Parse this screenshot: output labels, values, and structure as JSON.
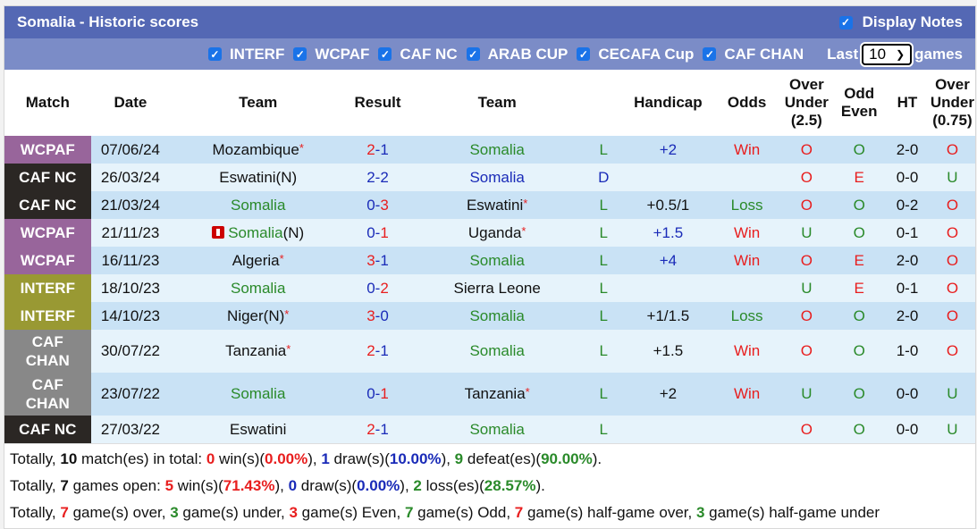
{
  "header": {
    "title": "Somalia - Historic scores",
    "display_notes_label": "Display Notes",
    "display_notes_checked": true
  },
  "filters": {
    "items": [
      {
        "label": "INTERF",
        "checked": true
      },
      {
        "label": "WCPAF",
        "checked": true
      },
      {
        "label": "CAF NC",
        "checked": true
      },
      {
        "label": "ARAB CUP",
        "checked": true
      },
      {
        "label": "CECAFA Cup",
        "checked": true
      },
      {
        "label": "CAF CHAN",
        "checked": true
      }
    ],
    "last_label": "Last",
    "games_label": "games",
    "last_value": "10",
    "checkmark": "✓",
    "chevron": "⌄"
  },
  "colors": {
    "WCPAF": "#98659b",
    "CAF NC": "#2b2724",
    "INTERF": "#999933",
    "CAF CHAN": "#888888"
  },
  "table": {
    "headers": {
      "match": "Match",
      "date": "Date",
      "team1": "Team",
      "result": "Result",
      "team2": "Team",
      "hl": "",
      "handicap": "Handicap",
      "odds": "Odds",
      "ou25_1": "Over",
      "ou25_2": "Under",
      "ou25_3": "(2.5)",
      "oe_1": "Odd",
      "oe_2": "Even",
      "ht": "HT",
      "ou075_1": "Over",
      "ou075_2": "Under",
      "ou075_3": "(0.75)"
    },
    "rows": [
      {
        "match": "WCPAF",
        "date": "07/06/24",
        "team1": "Mozambique",
        "team1_star": "*",
        "team1_flag": false,
        "team1_color": "black",
        "score1": "2",
        "score2": "1",
        "team2": "Somalia",
        "team2_star": "",
        "team2_color": "green",
        "wdl": "L",
        "handicap": "+2",
        "hcolor": "blue",
        "odds": "Win",
        "ou": "O",
        "oe": "O",
        "ht": "2-0",
        "ou2": "O"
      },
      {
        "match": "CAF NC",
        "date": "26/03/24",
        "team1": "Eswatini(N)",
        "team1_star": "",
        "team1_flag": false,
        "team1_color": "black",
        "score1": "2",
        "score2": "2",
        "team2": "Somalia",
        "team2_star": "",
        "team2_color": "blue",
        "wdl": "D",
        "handicap": "",
        "hcolor": "black",
        "odds": "",
        "ou": "O",
        "oe": "E",
        "ht": "0-0",
        "ou2": "U"
      },
      {
        "match": "CAF NC",
        "date": "21/03/24",
        "team1": "Somalia",
        "team1_star": "",
        "team1_flag": false,
        "team1_color": "green",
        "score1": "0",
        "score2": "3",
        "team2": "Eswatini",
        "team2_star": "*",
        "team2_color": "black",
        "wdl": "L",
        "handicap": "+0.5/1",
        "hcolor": "black",
        "odds": "Loss",
        "ou": "O",
        "oe": "O",
        "ht": "0-2",
        "ou2": "O"
      },
      {
        "match": "WCPAF",
        "date": "21/11/23",
        "team1": "Somalia",
        "team1_suffix": "(N)",
        "team1_star": "",
        "team1_flag": true,
        "team1_color": "green",
        "score1": "0",
        "score2": "1",
        "team2": "Uganda",
        "team2_star": "*",
        "team2_color": "black",
        "wdl": "L",
        "handicap": "+1.5",
        "hcolor": "blue",
        "odds": "Win",
        "ou": "U",
        "oe": "O",
        "ht": "0-1",
        "ou2": "O"
      },
      {
        "match": "WCPAF",
        "date": "16/11/23",
        "team1": "Algeria",
        "team1_star": "*",
        "team1_flag": false,
        "team1_color": "black",
        "score1": "3",
        "score2": "1",
        "team2": "Somalia",
        "team2_star": "",
        "team2_color": "green",
        "wdl": "L",
        "handicap": "+4",
        "hcolor": "blue",
        "odds": "Win",
        "ou": "O",
        "oe": "E",
        "ht": "2-0",
        "ou2": "O"
      },
      {
        "match": "INTERF",
        "date": "18/10/23",
        "team1": "Somalia",
        "team1_star": "",
        "team1_flag": false,
        "team1_color": "green",
        "score1": "0",
        "score2": "2",
        "team2": "Sierra Leone",
        "team2_star": "",
        "team2_color": "black",
        "wdl": "L",
        "handicap": "",
        "hcolor": "black",
        "odds": "",
        "ou": "U",
        "oe": "E",
        "ht": "0-1",
        "ou2": "O"
      },
      {
        "match": "INTERF",
        "date": "14/10/23",
        "team1": "Niger(N)",
        "team1_star": "*",
        "team1_flag": false,
        "team1_color": "black",
        "score1": "3",
        "score2": "0",
        "team2": "Somalia",
        "team2_star": "",
        "team2_color": "green",
        "wdl": "L",
        "handicap": "+1/1.5",
        "hcolor": "black",
        "odds": "Loss",
        "ou": "O",
        "oe": "O",
        "ht": "2-0",
        "ou2": "O"
      },
      {
        "match": "CAF CHAN",
        "date": "30/07/22",
        "team1": "Tanzania",
        "team1_star": "*",
        "team1_flag": false,
        "team1_color": "black",
        "score1": "2",
        "score2": "1",
        "team2": "Somalia",
        "team2_star": "",
        "team2_color": "green",
        "wdl": "L",
        "handicap": "+1.5",
        "hcolor": "black",
        "odds": "Win",
        "ou": "O",
        "oe": "O",
        "ht": "1-0",
        "ou2": "O"
      },
      {
        "match": "CAF CHAN",
        "date": "23/07/22",
        "team1": "Somalia",
        "team1_star": "",
        "team1_flag": false,
        "team1_color": "green",
        "score1": "0",
        "score2": "1",
        "team2": "Tanzania",
        "team2_star": "*",
        "team2_color": "black",
        "wdl": "L",
        "handicap": "+2",
        "hcolor": "black",
        "odds": "Win",
        "ou": "U",
        "oe": "O",
        "ht": "0-0",
        "ou2": "U"
      },
      {
        "match": "CAF NC",
        "date": "27/03/22",
        "team1": "Eswatini",
        "team1_star": "",
        "team1_flag": false,
        "team1_color": "black",
        "score1": "2",
        "score2": "1",
        "team2": "Somalia",
        "team2_star": "",
        "team2_color": "green",
        "wdl": "L",
        "handicap": "",
        "hcolor": "black",
        "odds": "",
        "ou": "O",
        "oe": "O",
        "ht": "0-0",
        "ou2": "U"
      }
    ]
  },
  "summary": [
    [
      [
        "Totally, ",
        ""
      ],
      [
        "10",
        "black"
      ],
      [
        " match(es) in total: ",
        ""
      ],
      [
        "0",
        "red"
      ],
      [
        " win(s)(",
        ""
      ],
      [
        "0.00%",
        "red"
      ],
      [
        "), ",
        ""
      ],
      [
        "1",
        "blue"
      ],
      [
        " draw(s)(",
        ""
      ],
      [
        "10.00%",
        "blue"
      ],
      [
        "), ",
        ""
      ],
      [
        "9",
        "green"
      ],
      [
        " defeat(es)(",
        ""
      ],
      [
        "90.00%",
        "green"
      ],
      [
        ").",
        ""
      ]
    ],
    [
      [
        "Totally, ",
        ""
      ],
      [
        "7",
        "black"
      ],
      [
        " games open: ",
        ""
      ],
      [
        "5",
        "red"
      ],
      [
        " win(s)(",
        ""
      ],
      [
        "71.43%",
        "red"
      ],
      [
        "), ",
        ""
      ],
      [
        "0",
        "blue"
      ],
      [
        " draw(s)(",
        ""
      ],
      [
        "0.00%",
        "blue"
      ],
      [
        "), ",
        ""
      ],
      [
        "2",
        "green"
      ],
      [
        " loss(es)(",
        ""
      ],
      [
        "28.57%",
        "green"
      ],
      [
        ").",
        ""
      ]
    ],
    [
      [
        "Totally, ",
        ""
      ],
      [
        "7",
        "red"
      ],
      [
        " game(s) over, ",
        ""
      ],
      [
        "3",
        "green"
      ],
      [
        " game(s) under, ",
        ""
      ],
      [
        "3",
        "red"
      ],
      [
        " game(s) Even, ",
        ""
      ],
      [
        "7",
        "green"
      ],
      [
        " game(s) Odd, ",
        ""
      ],
      [
        "7",
        "red"
      ],
      [
        " game(s) half-game over, ",
        ""
      ],
      [
        "3",
        "green"
      ],
      [
        " game(s) half-game under",
        ""
      ]
    ]
  ]
}
